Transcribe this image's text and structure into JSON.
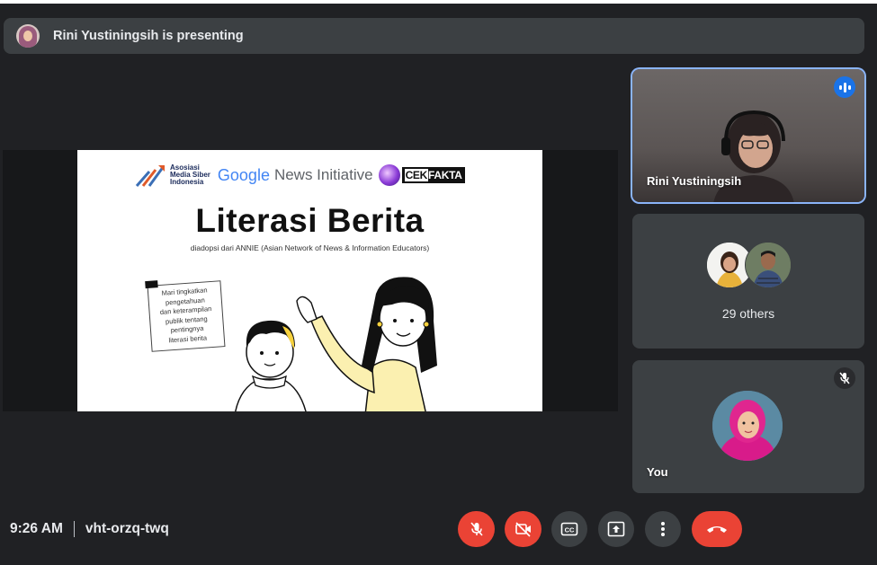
{
  "banner": {
    "presenting_text": "Rini Yustiningsih is presenting"
  },
  "slide": {
    "logo_amsi_line1": "Asosiasi",
    "logo_amsi_line2": "Media Siber",
    "logo_amsi_line3": "Indonesia",
    "logo_google": "Google",
    "logo_news_initiative": "News Initiative",
    "logo_cek": "CEK",
    "logo_fakta": "FAKTA",
    "title": "Literasi Berita",
    "subtitle": "diadopsi dari ANNIE (Asian Network of News & Information Educators)",
    "note": "Mari tingkatkan\npengetahuan\ndan keterampilan\npublik tentang\npentingnya\nliterasi berita"
  },
  "participants": {
    "presenter_name": "Rini Yustiningsih",
    "others_label": "29 others",
    "self_label": "You"
  },
  "footer": {
    "time": "9:26 AM",
    "meeting_code": "vht-orzq-twq"
  },
  "colors": {
    "background": "#202124",
    "tile": "#3c4043",
    "danger": "#ea4335",
    "active_speaker": "#8ab4f8"
  },
  "icons": [
    "mic-off-icon",
    "camera-off-icon",
    "captions-icon",
    "present-icon",
    "more-vert-icon",
    "call-end-icon",
    "speaking-indicator-icon",
    "muted-mic-icon"
  ]
}
